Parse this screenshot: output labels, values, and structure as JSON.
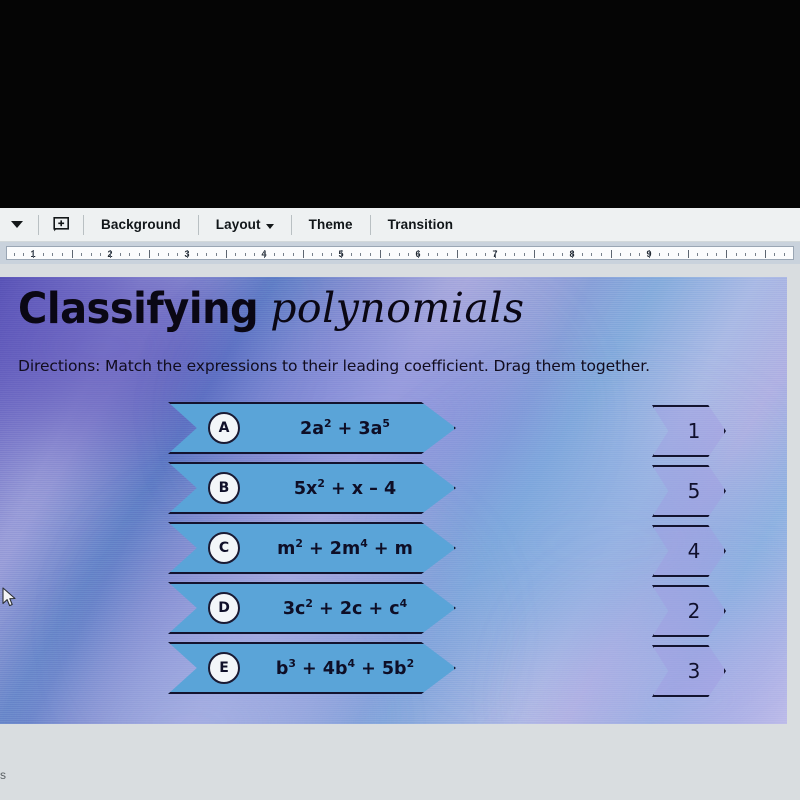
{
  "app": {
    "letterbox_color": "#050505",
    "canvas_bg": "#d9dde0"
  },
  "toolbar": {
    "caret_icon": "chevron-down-icon",
    "new_slide_icon": "new-slide-icon",
    "items": [
      {
        "label": "Background",
        "has_caret": false
      },
      {
        "label": "Layout",
        "has_caret": true
      },
      {
        "label": "Theme",
        "has_caret": false
      },
      {
        "label": "Transition",
        "has_caret": false
      }
    ]
  },
  "ruler": {
    "numbers": [
      "1",
      "2",
      "3",
      "4",
      "5",
      "6",
      "7",
      "8",
      "9"
    ]
  },
  "slide": {
    "title_bold": "Classifying",
    "title_script": "polynomials",
    "directions": "Directions: Match the expressions to their leading coefficient. Drag them together.",
    "accent_banner_color": "#5aa4d8",
    "accent_outline_color": "#13132e",
    "banners": [
      {
        "letter": "A",
        "expr_html": "2a<sup>2</sup> + 3a<sup>5</sup>",
        "expr_text": "2a^2 + 3a^5"
      },
      {
        "letter": "B",
        "expr_html": "5x<sup>2</sup> + x &ndash; 4",
        "expr_text": "5x^2 + x - 4"
      },
      {
        "letter": "C",
        "expr_html": "m<sup>2</sup> + 2m<sup>4</sup> + m",
        "expr_text": "m^2 + 2m^4 + m"
      },
      {
        "letter": "D",
        "expr_html": "3c<sup>2</sup> + 2c + c<sup>4</sup>",
        "expr_text": "3c^2 + 2c + c^4"
      },
      {
        "letter": "E",
        "expr_html": "b<sup>3</sup> + 4b<sup>4</sup> + 5b<sup>2</sup>",
        "expr_text": "b^3 + 4b^4 + 5b^2"
      }
    ],
    "tags": [
      "1",
      "5",
      "4",
      "2",
      "3"
    ]
  },
  "cursor": {
    "icon": "mouse-pointer-icon"
  },
  "bottom_glyph": "s"
}
